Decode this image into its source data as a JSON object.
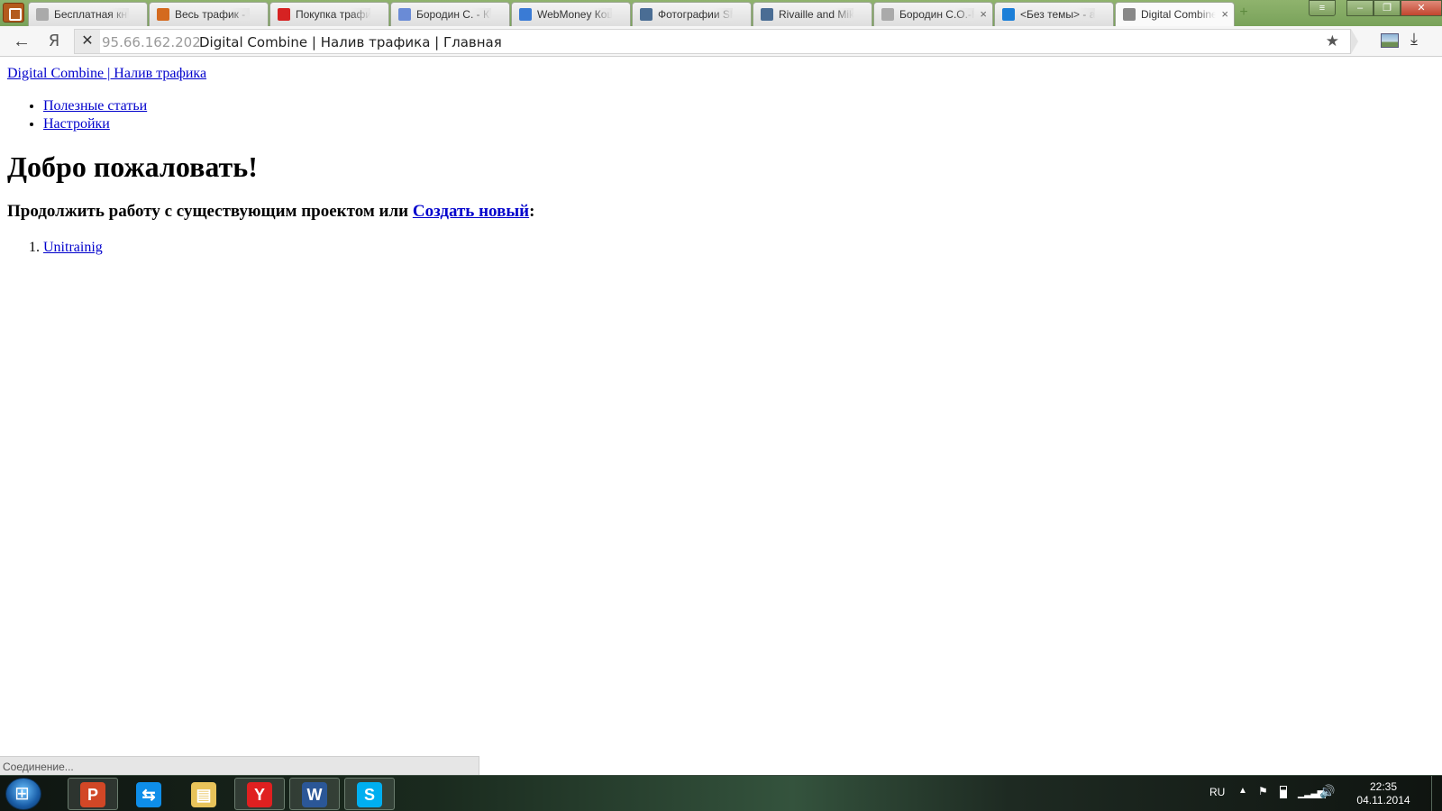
{
  "browser": {
    "tabs": [
      {
        "label": "Бесплатная кн",
        "favicon": "page-icon",
        "color": "#aaaaaa"
      },
      {
        "label": "Весь трафик - С",
        "favicon": "chart-icon",
        "color": "#d46a1f"
      },
      {
        "label": "Покупка трафи",
        "favicon": "yandex-icon",
        "color": "#d62222"
      },
      {
        "label": "Бородин С. - К",
        "favicon": "pinwheel-icon",
        "color": "#6a8bd6"
      },
      {
        "label": "WebMoney Кош",
        "favicon": "globe-icon",
        "color": "#3a7bd5"
      },
      {
        "label": "Фотографии Sh",
        "favicon": "vk-icon",
        "color": "#4a6d94"
      },
      {
        "label": "Rivaille and Mik",
        "favicon": "vk-icon",
        "color": "#4a6d94"
      },
      {
        "label": "Бородин С.О.-К",
        "favicon": "page-icon",
        "color": "#aaaaaa",
        "close": "×"
      },
      {
        "label": "<Без темы> - a",
        "favicon": "mail-icon",
        "color": "#1c7fd8"
      },
      {
        "label": "Digital Combine",
        "favicon": "loading-icon",
        "color": "#888888",
        "close": "×",
        "active": true
      }
    ],
    "new_tab": "+",
    "window_buttons": {
      "menu": "≡",
      "minimize": "–",
      "maximize": "❐",
      "close": "✕"
    },
    "nav": {
      "back": "←",
      "yandex": "Я",
      "stop": "✕",
      "host": "95.66.162.202",
      "title": "Digital Combine | Налив трафика | Главная",
      "star": "★",
      "download": "⤓"
    }
  },
  "page": {
    "site_link": "Digital Combine | Налив трафика",
    "nav_items": [
      "Полезные статьи",
      "Настройки"
    ],
    "heading": "Добро пожаловать!",
    "continue_text": "Продолжить работу с существующим проектом или ",
    "create_link": "Создать новый",
    "continue_suffix": ":",
    "projects": [
      "Unitrainig"
    ]
  },
  "status_bar": "Соединение...",
  "taskbar": {
    "apps": [
      {
        "name": "powerpoint-icon",
        "glyph": "P",
        "color": "#d24726",
        "open": true
      },
      {
        "name": "teamviewer-icon",
        "glyph": "⇆",
        "color": "#0e8ee9",
        "open": false
      },
      {
        "name": "file-explorer-icon",
        "glyph": "▤",
        "color": "#e8c35a",
        "open": false
      },
      {
        "name": "yandex-browser-icon",
        "glyph": "Y",
        "color": "#e02020",
        "open": true
      },
      {
        "name": "word-icon",
        "glyph": "W",
        "color": "#2b5797",
        "open": true
      },
      {
        "name": "skype-icon",
        "glyph": "S",
        "color": "#00aff0",
        "open": true
      }
    ],
    "tray": {
      "language": "RU",
      "up_arrow": "▲",
      "flag": "⚑",
      "signal": "▁▂▃▅",
      "volume": "🔊",
      "time": "22:35",
      "date": "04.11.2014"
    }
  }
}
